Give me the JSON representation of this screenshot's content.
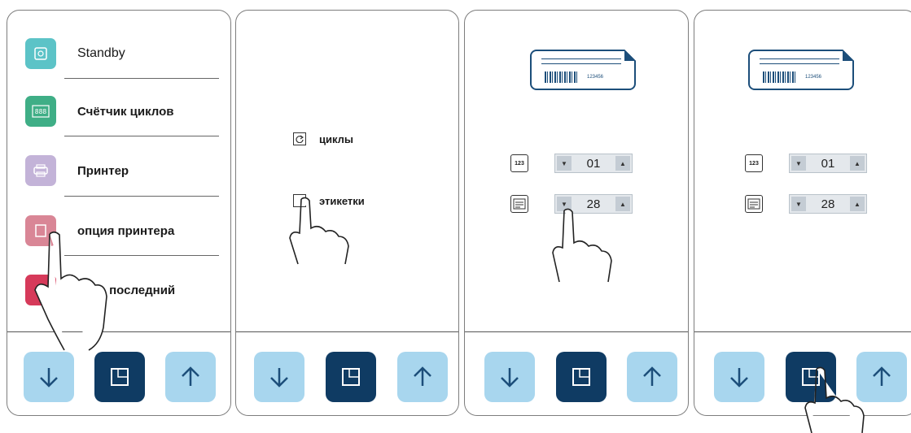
{
  "panels": [
    {
      "menu": [
        {
          "label": "Standby",
          "icon": "standby-icon",
          "color": "#5cc3c7"
        },
        {
          "label": "Счётчик циклов",
          "icon": "cycle-counter-icon",
          "color": "#3fae86"
        },
        {
          "label": "Принтер",
          "icon": "printer-icon",
          "color": "#c3b3d8"
        },
        {
          "label": "опция принтера",
          "icon": "printer-option-icon",
          "color": "#d98696"
        },
        {
          "label": "ать последний",
          "icon": "print-last-icon",
          "color": "#d63a5a"
        }
      ]
    },
    {
      "options": [
        {
          "label": "циклы",
          "icon": "cycles-icon"
        },
        {
          "label": "этикетки",
          "icon": "labels-icon"
        }
      ]
    },
    {
      "ticket_number": "123456",
      "steppers": [
        {
          "icon_text": "123",
          "value": "01"
        },
        {
          "icon_text": "",
          "value": "28"
        }
      ]
    },
    {
      "ticket_number": "123456",
      "steppers": [
        {
          "icon_text": "123",
          "value": "01"
        },
        {
          "icon_text": "",
          "value": "28"
        }
      ]
    }
  ],
  "colors": {
    "button_light": "#a8d6ee",
    "button_dark": "#0f3b63",
    "ticket_blue": "#1c4e7a"
  }
}
